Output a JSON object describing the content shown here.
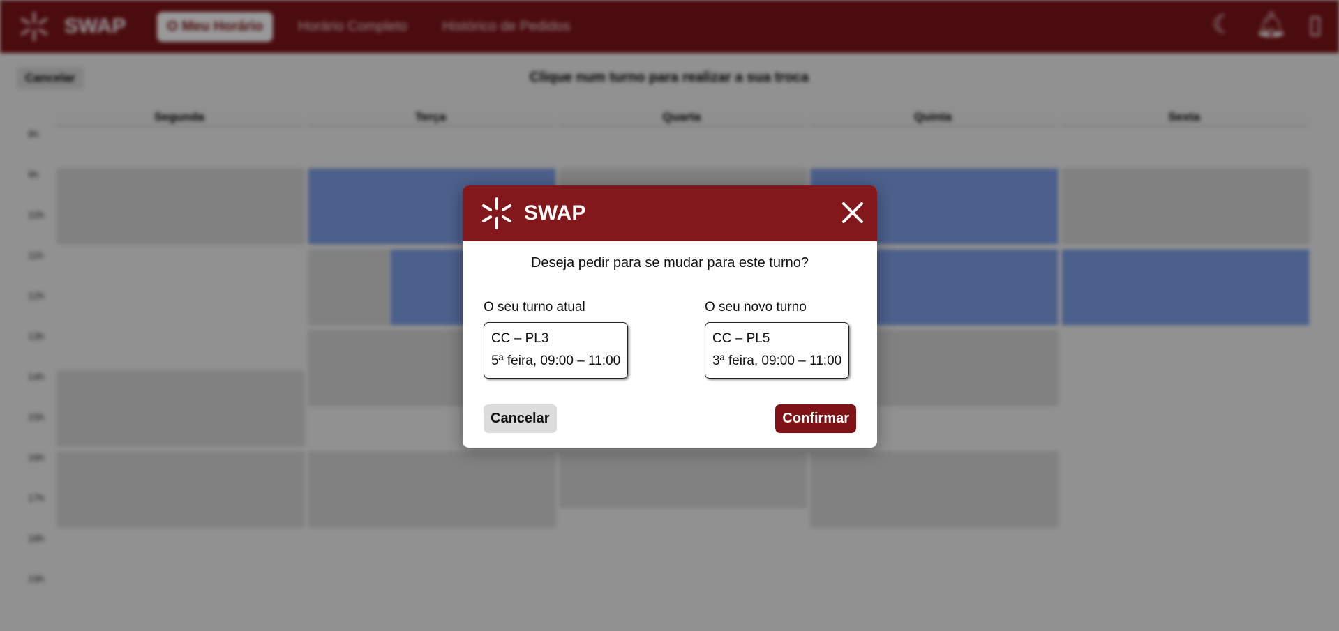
{
  "app": {
    "brand": "SWAP",
    "nav": [
      "O Meu Horário",
      "Horário Completo",
      "Histórico de Pedidos"
    ],
    "icons": [
      "moon-icon",
      "bell-icon",
      "logout-icon"
    ]
  },
  "background": {
    "cancel_label": "Cancelar",
    "hint": "Clique num turno para realizar a sua troca",
    "days": [
      "Segunda",
      "Terça",
      "Quarta",
      "Quinta",
      "Sexta"
    ],
    "hours": [
      "8h",
      "9h",
      "10h",
      "11h",
      "12h",
      "13h",
      "14h",
      "15h",
      "16h",
      "17h",
      "18h",
      "19h"
    ]
  },
  "modal": {
    "title": "SWAP",
    "question": "Deseja pedir para se mudar para este turno?",
    "current": {
      "label": "O seu turno atual",
      "line1": "CC – PL3",
      "line2": "5ª feira, 09:00 – 11:00"
    },
    "new": {
      "label": "O seu novo turno",
      "line1": "CC – PL5",
      "line2": "3ª feira, 09:00 – 11:00"
    },
    "cancel_label": "Cancelar",
    "confirm_label": "Confirmar"
  },
  "colors": {
    "brand": "#82181b",
    "shift_gray": "#d8d8d8",
    "shift_blue": "#7fa0ea"
  }
}
